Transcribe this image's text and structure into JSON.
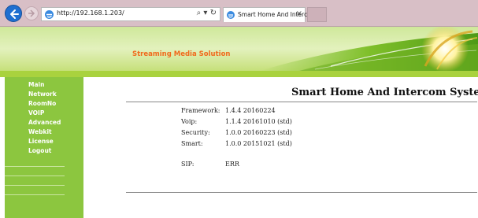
{
  "browser": {
    "url": "http://192.168.1.203/",
    "address_controls": "⌕ ▾ ↻",
    "tab_title": "Smart Home And Intercom ...",
    "tab_close": "×"
  },
  "banner": {
    "text": "Streaming Media Solution"
  },
  "sidebar": {
    "items": [
      {
        "label": "Main"
      },
      {
        "label": "Network"
      },
      {
        "label": "RoomNo"
      },
      {
        "label": "VOIP"
      },
      {
        "label": "Advanced"
      },
      {
        "label": "Webkit"
      },
      {
        "label": "License"
      },
      {
        "label": "Logout"
      }
    ]
  },
  "main": {
    "title": "Smart Home And Intercom System",
    "versions": [
      {
        "label": "Framework:",
        "value": "1.4.4 20160224"
      },
      {
        "label": "Voip:",
        "value": "1.1.4 20161010 (std)"
      },
      {
        "label": "Security:",
        "value": "1.0.0 20160223 (std)"
      },
      {
        "label": "Smart:",
        "value": "1.0.0 20151021 (std)"
      }
    ],
    "sip": {
      "label": "SIP:",
      "value": "ERR"
    }
  },
  "colors": {
    "sidebar": "#8cc63f",
    "banner_text": "#f06a1c",
    "chrome": "#d8bfc6",
    "back_button": "#1f6fd0"
  }
}
